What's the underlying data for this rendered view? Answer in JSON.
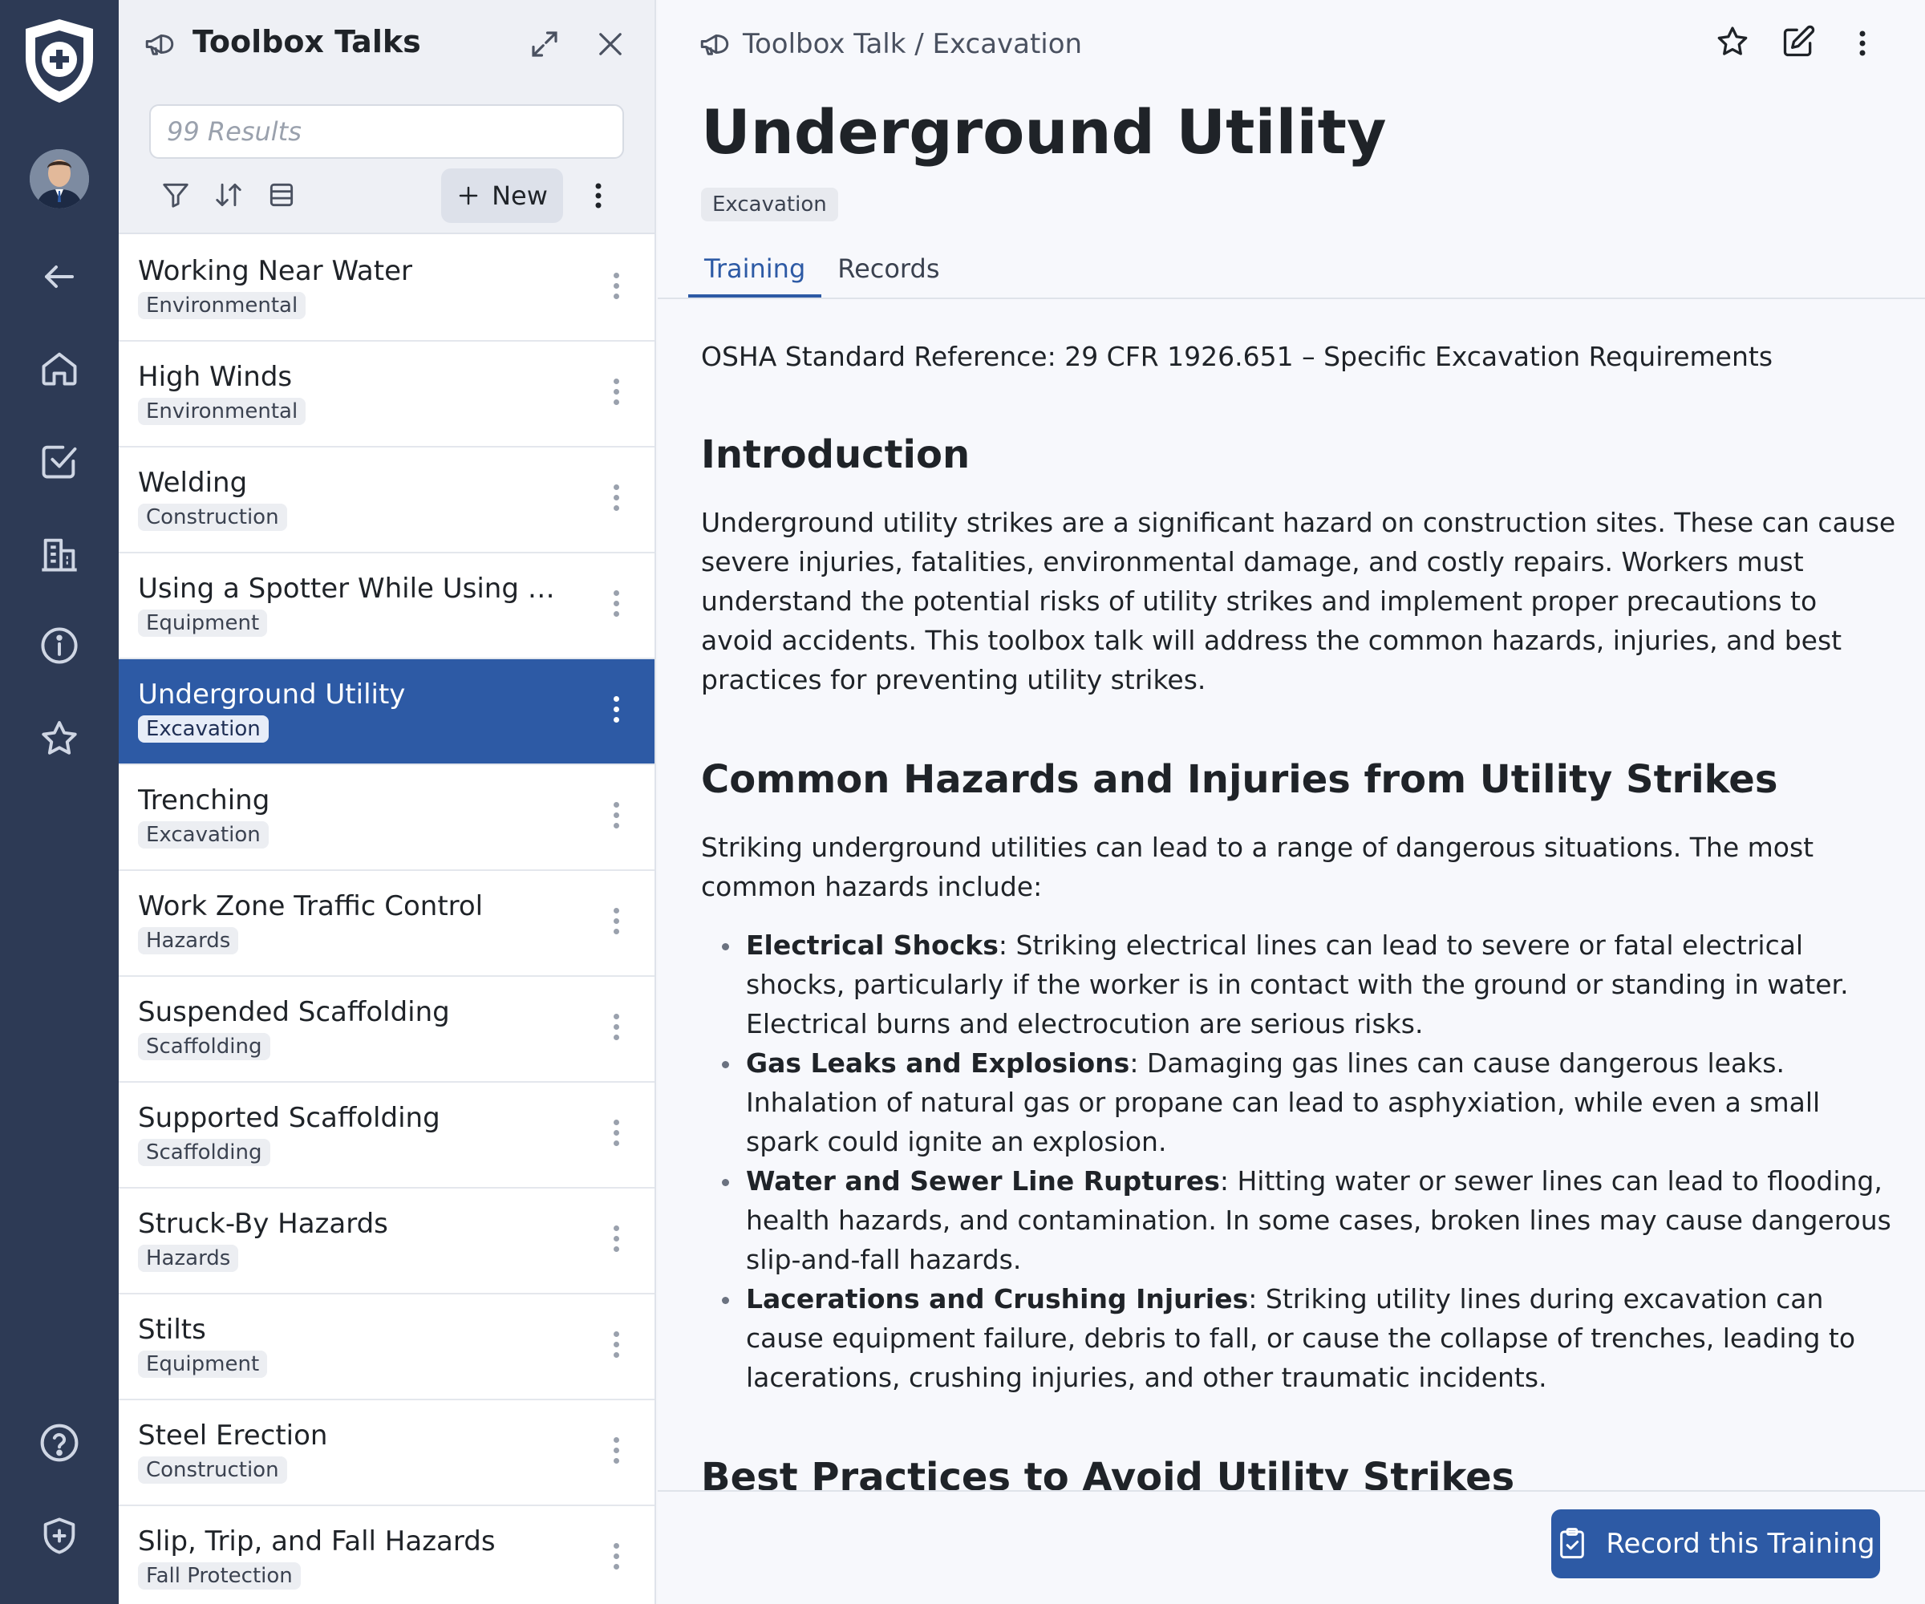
{
  "rail": {
    "logo_icon": "shield-plus-icon",
    "items": [
      {
        "icon": "arrow-left-icon",
        "label": "Back"
      },
      {
        "icon": "home-icon",
        "label": "Home"
      },
      {
        "icon": "checkbox-icon",
        "label": "Tasks"
      },
      {
        "icon": "building-icon",
        "label": "Sites"
      },
      {
        "icon": "info-icon",
        "label": "Info"
      },
      {
        "icon": "star-icon",
        "label": "Favorites"
      }
    ],
    "bottom": [
      {
        "icon": "help-icon"
      },
      {
        "icon": "shield-small-icon"
      }
    ]
  },
  "panel": {
    "title": "Toolbox Talks",
    "search_placeholder": "99 Results",
    "new_label": "New",
    "items": [
      {
        "name": "Working Near Water",
        "category": "Environmental"
      },
      {
        "name": "High Winds",
        "category": "Environmental"
      },
      {
        "name": "Welding",
        "category": "Construction"
      },
      {
        "name": "Using a Spotter While Using Mob...",
        "category": "Equipment"
      },
      {
        "name": "Underground Utility",
        "category": "Excavation",
        "selected": true
      },
      {
        "name": "Trenching",
        "category": "Excavation"
      },
      {
        "name": "Work Zone Traffic Control",
        "category": "Hazards"
      },
      {
        "name": "Suspended Scaffolding",
        "category": "Scaffolding"
      },
      {
        "name": "Supported Scaffolding",
        "category": "Scaffolding"
      },
      {
        "name": "Struck-By Hazards",
        "category": "Hazards"
      },
      {
        "name": "Stilts",
        "category": "Equipment"
      },
      {
        "name": "Steel Erection",
        "category": "Construction"
      },
      {
        "name": "Slip, Trip, and Fall Hazards",
        "category": "Fall Protection"
      }
    ]
  },
  "main": {
    "breadcrumb": "Toolbox Talk / Excavation",
    "title": "Underground Utility",
    "badge": "Excavation",
    "tabs": [
      "Training",
      "Records"
    ],
    "reference": "OSHA Standard Reference: 29 CFR 1926.651 – Specific Excavation Requirements",
    "intro_heading": "Introduction",
    "intro_text": "Underground utility strikes are a significant hazard on construction sites. These can cause severe injuries, fatalities, environmental damage, and costly repairs. Workers must understand the potential risks of utility strikes and implement proper precautions to avoid accidents. This toolbox talk will address the common hazards, injuries, and best practices for preventing utility strikes.",
    "hazards_heading": "Common Hazards and Injuries from Utility Strikes",
    "hazards_intro": "Striking underground utilities can lead to a range of dangerous situations. The most common hazards include:",
    "hazards": [
      {
        "term": "Electrical Shocks",
        "text": ": Striking electrical lines can lead to severe or fatal electrical shocks, particularly if the worker is in contact with the ground or standing in water. Electrical burns and electrocution are serious risks."
      },
      {
        "term": "Gas Leaks and Explosions",
        "text": ": Damaging gas lines can cause dangerous leaks. Inhalation of natural gas or propane can lead to asphyxiation, while even a small spark could ignite an explosion."
      },
      {
        "term": "Water and Sewer Line Ruptures",
        "text": ": Hitting water or sewer lines can lead to flooding, health hazards, and contamination. In some cases, broken lines may cause dangerous slip-and-fall hazards."
      },
      {
        "term": "Lacerations and Crushing Injuries",
        "text": ": Striking utility lines during excavation can cause equipment failure, debris to fall, or cause the collapse of trenches, leading to lacerations, crushing injuries, and other traumatic incidents."
      }
    ],
    "best_practices_heading": "Best Practices to Avoid Utility Strikes",
    "record_button": "Record this Training"
  },
  "colors": {
    "rail": "#2d3a55",
    "accent": "#2d5aa5"
  }
}
